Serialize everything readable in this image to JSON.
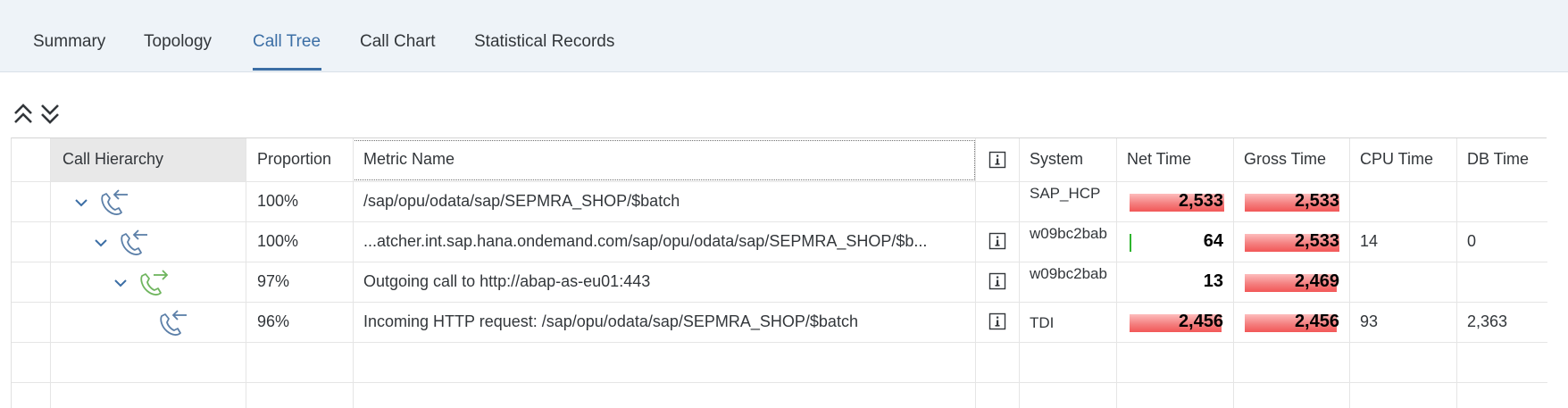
{
  "tabs": [
    {
      "label": "Summary",
      "active": false
    },
    {
      "label": "Topology",
      "active": false
    },
    {
      "label": "Call Tree",
      "active": true
    },
    {
      "label": "Call Chart",
      "active": false
    },
    {
      "label": "Statistical Records",
      "active": false
    }
  ],
  "toolbar": {
    "collapse_all_icon": "double-chevron-up-icon",
    "expand_all_icon": "double-chevron-down-icon"
  },
  "table": {
    "columns": {
      "hierarchy": "Call Hierarchy",
      "proportion": "Proportion",
      "metric": "Metric Name",
      "info": "info-icon",
      "system": "System",
      "net": "Net Time",
      "gross": "Gross Time",
      "cpu": "CPU Time",
      "db": "DB Time"
    },
    "rows": [
      {
        "level": 0,
        "expanded": true,
        "icon": "incoming-call-icon",
        "proportion": "100%",
        "metric": "/sap/opu/odata/sap/SEPMRA_SHOP/$batch",
        "has_info": false,
        "system": "SAP_HCP",
        "net": "2,533",
        "net_fraction": 1.0,
        "gross": "2,533",
        "gross_fraction": 1.0,
        "cpu": "",
        "db": ""
      },
      {
        "level": 1,
        "expanded": true,
        "icon": "incoming-call-icon",
        "proportion": "100%",
        "metric": "...atcher.int.sap.hana.ondemand.com/sap/opu/odata/sap/SEPMRA_SHOP/$b...",
        "has_info": true,
        "system": "w09bc2bab",
        "net": "64",
        "net_fraction": 0.025,
        "gross": "2,533",
        "gross_fraction": 1.0,
        "cpu": "14",
        "db": "0"
      },
      {
        "level": 2,
        "expanded": true,
        "icon": "outgoing-call-icon",
        "proportion": "97%",
        "metric": "Outgoing call to http://abap-as-eu01:443",
        "has_info": true,
        "system": "w09bc2bab",
        "net": "13",
        "net_fraction": 0.005,
        "gross": "2,469",
        "gross_fraction": 0.975,
        "cpu": "",
        "db": ""
      },
      {
        "level": 3,
        "expanded": false,
        "icon": "incoming-call-icon",
        "proportion": "96%",
        "metric": "Incoming HTTP request: /sap/opu/odata/sap/SEPMRA_SHOP/$batch",
        "has_info": true,
        "system": "TDI",
        "net": "2,456",
        "net_fraction": 0.97,
        "gross": "2,456",
        "gross_fraction": 0.97,
        "cpu": "93",
        "db": "2,363"
      }
    ]
  },
  "colors": {
    "accent": "#3b6ea5",
    "bar_red": "#f25757",
    "bar_green": "#2db52d",
    "incoming_icon": "#5b7fa8",
    "outgoing_icon": "#6fb55e"
  }
}
